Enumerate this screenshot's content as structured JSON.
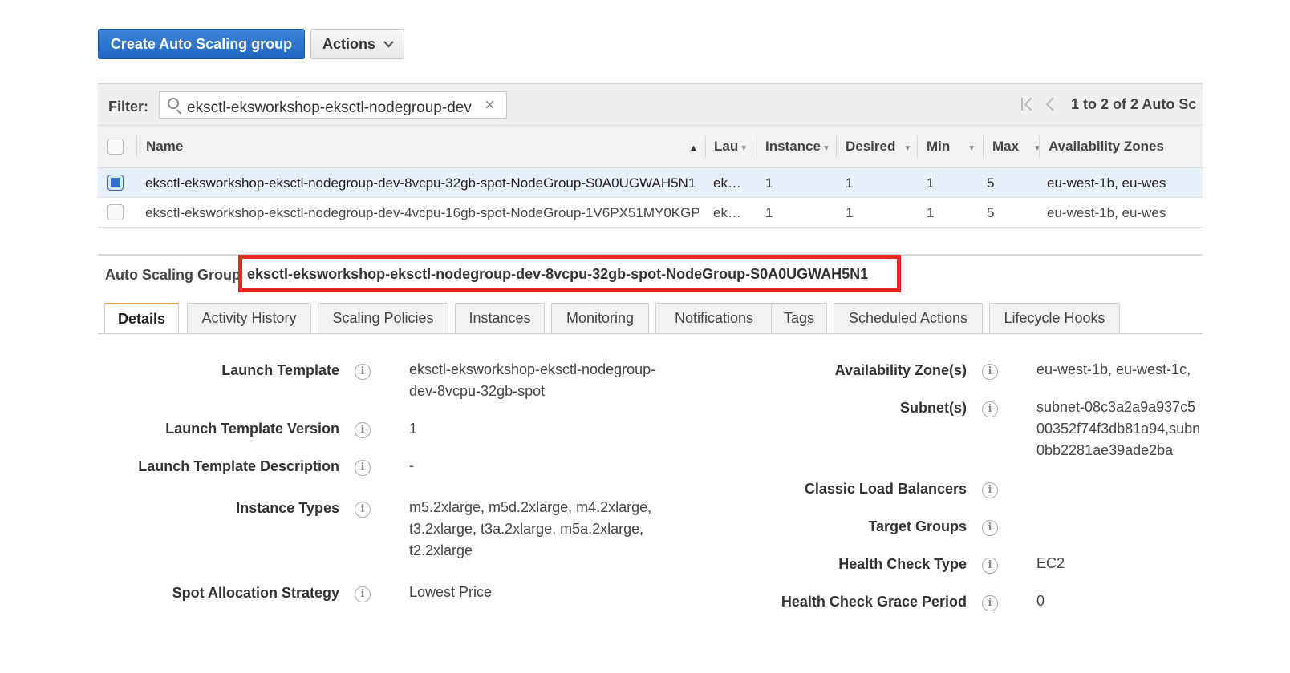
{
  "toolbar": {
    "create_label": "Create Auto Scaling group",
    "actions_label": "Actions"
  },
  "filter": {
    "label": "Filter:",
    "value": "eksctl-eksworkshop-eksctl-nodegroup-dev",
    "pagination": "1 to 2 of 2 Auto Sc"
  },
  "table": {
    "columns": [
      "Name",
      "Lau",
      "Instance",
      "Desired",
      "Min",
      "Max",
      "Availability Zones"
    ],
    "rows": [
      {
        "selected": true,
        "name": "eksctl-eksworkshop-eksctl-nodegroup-dev-8vcpu-32gb-spot-NodeGroup-S0A0UGWAH5N1",
        "launch": "ek…",
        "instances": "1",
        "desired": "1",
        "min": "1",
        "max": "5",
        "zones": "eu-west-1b, eu-wes"
      },
      {
        "selected": false,
        "name": "eksctl-eksworkshop-eksctl-nodegroup-dev-4vcpu-16gb-spot-NodeGroup-1V6PX51MY0KGP",
        "launch": "ek…",
        "instances": "1",
        "desired": "1",
        "min": "1",
        "max": "5",
        "zones": "eu-west-1b, eu-wes"
      }
    ]
  },
  "detail": {
    "group_label": "Auto Scaling Group",
    "group_name": "eksctl-eksworkshop-eksctl-nodegroup-dev-8vcpu-32gb-spot-NodeGroup-S0A0UGWAH5N1",
    "highlight_color": "#e8251e"
  },
  "tabs": [
    "Details",
    "Activity History",
    "Scaling Policies",
    "Instances",
    "Monitoring",
    "Notifications",
    "Tags",
    "Scheduled Actions",
    "Lifecycle Hooks"
  ],
  "details_left": {
    "launch_template_label": "Launch Template",
    "launch_template_line1": "eksctl-eksworkshop-eksctl-nodegroup-",
    "launch_template_line2": "dev-8vcpu-32gb-spot",
    "version_label": "Launch Template Version",
    "version_value": "1",
    "description_label": "Launch Template Description",
    "description_value": "-",
    "instance_types_label": "Instance Types",
    "instance_types_line1": "m5.2xlarge, m5d.2xlarge, m4.2xlarge,",
    "instance_types_line2": "t3.2xlarge, t3a.2xlarge, m5a.2xlarge,",
    "instance_types_line3": "t2.2xlarge",
    "spot_label": "Spot Allocation Strategy",
    "spot_value": "Lowest Price"
  },
  "details_right": {
    "az_label": "Availability Zone(s)",
    "az_value": "eu-west-1b, eu-west-1c,",
    "subnets_label": "Subnet(s)",
    "subnets_line1": "subnet-08c3a2a9a937c5",
    "subnets_line2": "00352f74f3db81a94,subn",
    "subnets_line3": "0bb2281ae39ade2ba",
    "clb_label": "Classic Load Balancers",
    "tg_label": "Target Groups",
    "hc_type_label": "Health Check Type",
    "hc_type_value": "EC2",
    "hc_grace_label": "Health Check Grace Period",
    "hc_grace_value": "0"
  },
  "info_glyph": "i"
}
